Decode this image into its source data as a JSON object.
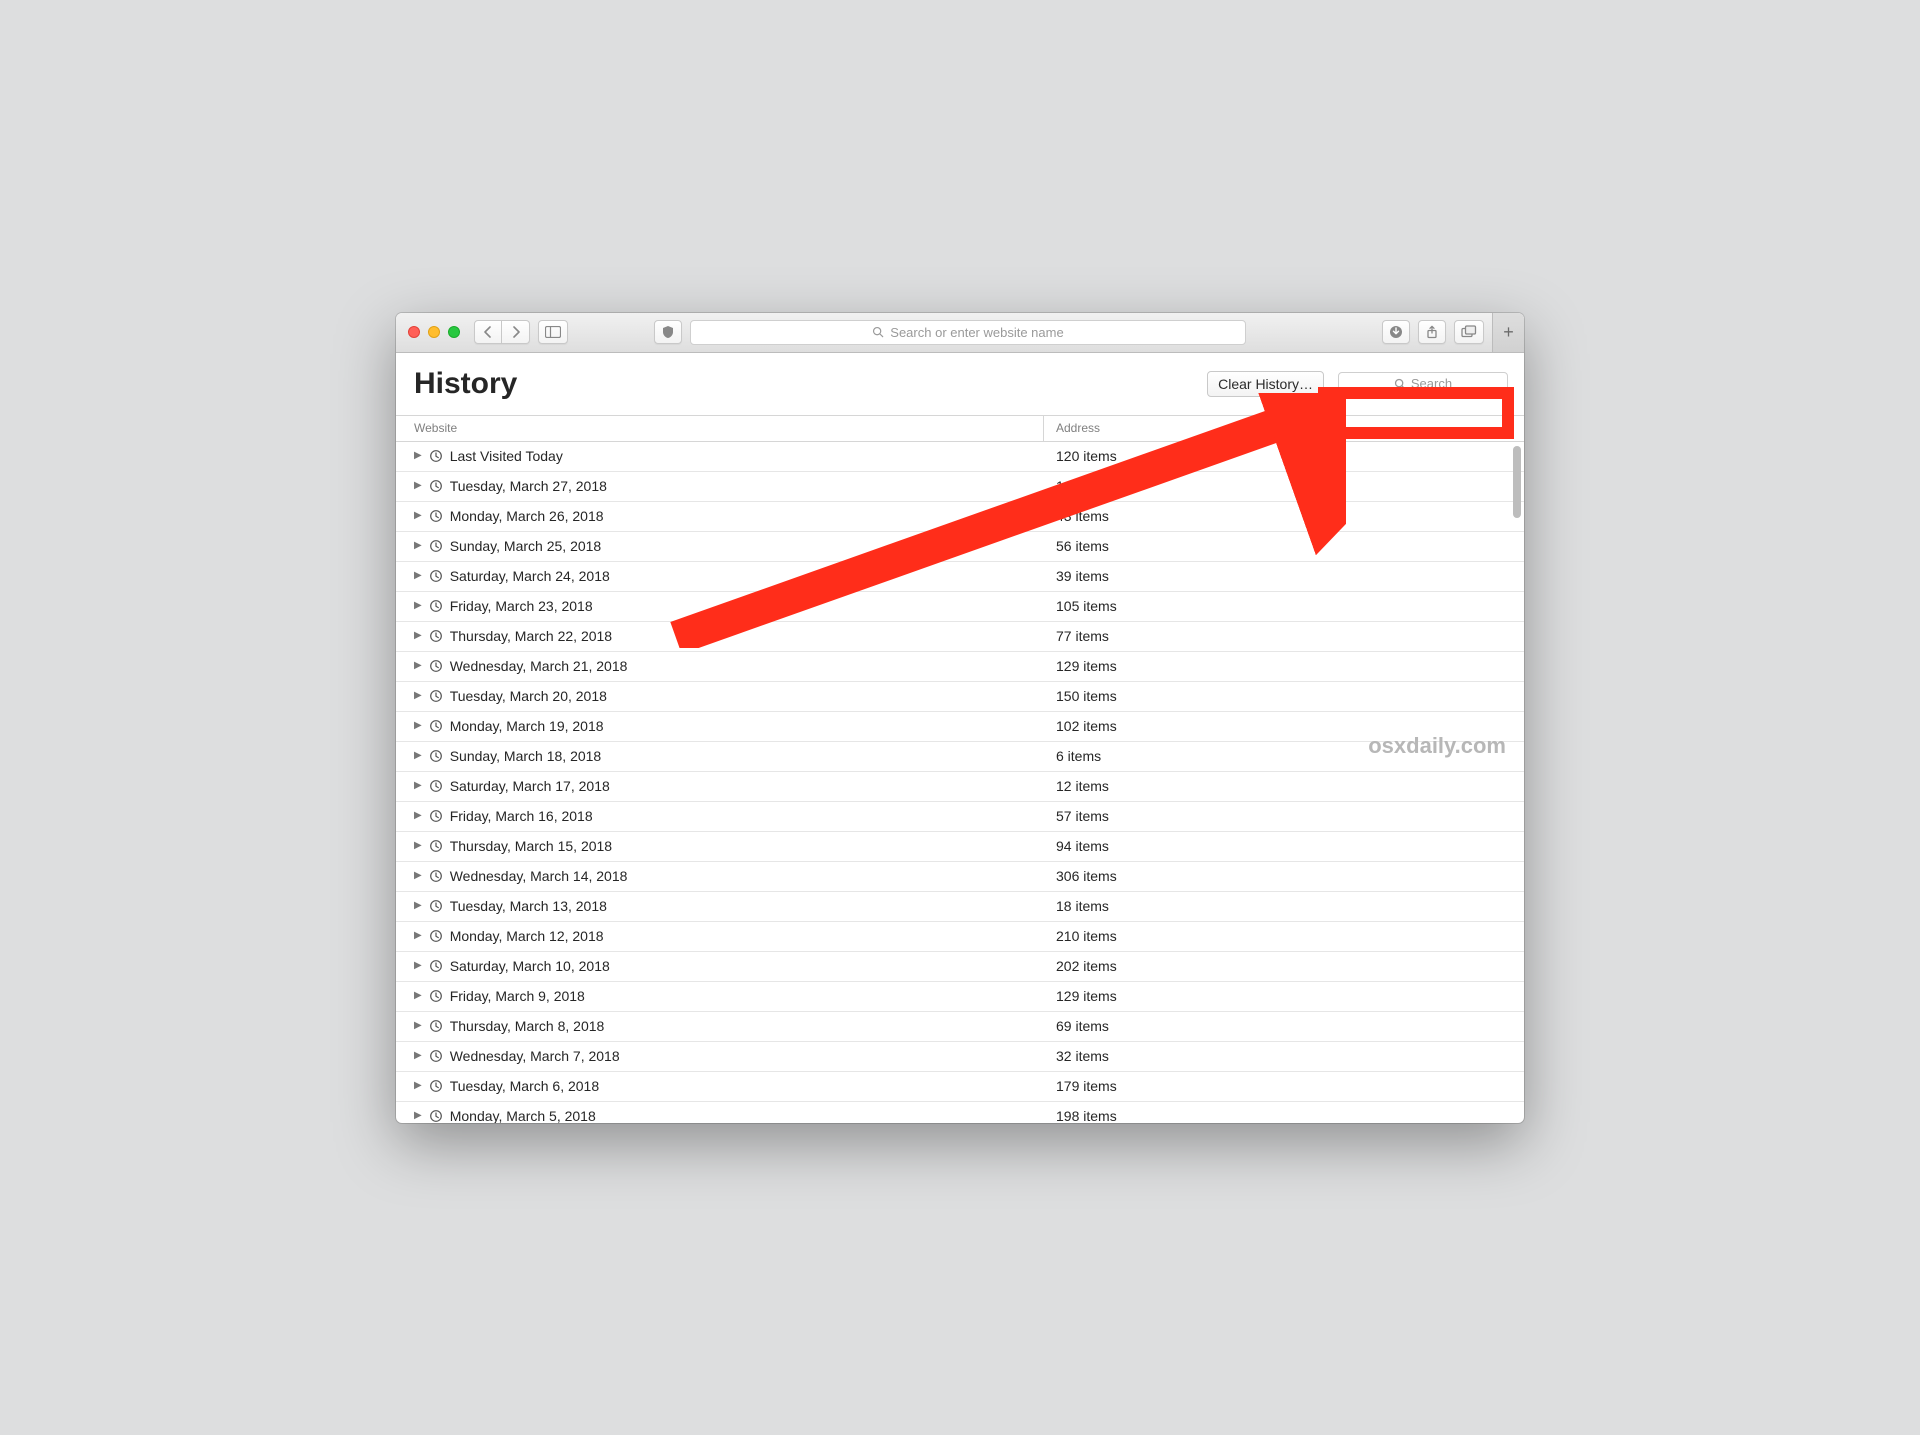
{
  "toolbar": {
    "address_placeholder": "Search or enter website name"
  },
  "history": {
    "title": "History",
    "clear_label": "Clear History…",
    "search_placeholder": "Search",
    "columns": {
      "website": "Website",
      "address": "Address"
    },
    "rows": [
      {
        "label": "Last Visited Today",
        "count": "120 items"
      },
      {
        "label": "Tuesday, March 27, 2018",
        "count": "196 items"
      },
      {
        "label": "Monday, March 26, 2018",
        "count": "43 items"
      },
      {
        "label": "Sunday, March 25, 2018",
        "count": "56 items"
      },
      {
        "label": "Saturday, March 24, 2018",
        "count": "39 items"
      },
      {
        "label": "Friday, March 23, 2018",
        "count": "105 items"
      },
      {
        "label": "Thursday, March 22, 2018",
        "count": "77 items"
      },
      {
        "label": "Wednesday, March 21, 2018",
        "count": "129 items"
      },
      {
        "label": "Tuesday, March 20, 2018",
        "count": "150 items"
      },
      {
        "label": "Monday, March 19, 2018",
        "count": "102 items"
      },
      {
        "label": "Sunday, March 18, 2018",
        "count": "6 items"
      },
      {
        "label": "Saturday, March 17, 2018",
        "count": "12 items"
      },
      {
        "label": "Friday, March 16, 2018",
        "count": "57 items"
      },
      {
        "label": "Thursday, March 15, 2018",
        "count": "94 items"
      },
      {
        "label": "Wednesday, March 14, 2018",
        "count": "306 items"
      },
      {
        "label": "Tuesday, March 13, 2018",
        "count": "18 items"
      },
      {
        "label": "Monday, March 12, 2018",
        "count": "210 items"
      },
      {
        "label": "Saturday, March 10, 2018",
        "count": "202 items"
      },
      {
        "label": "Friday, March 9, 2018",
        "count": "129 items"
      },
      {
        "label": "Thursday, March 8, 2018",
        "count": "69 items"
      },
      {
        "label": "Wednesday, March 7, 2018",
        "count": "32 items"
      },
      {
        "label": "Tuesday, March 6, 2018",
        "count": "179 items"
      },
      {
        "label": "Monday, March 5, 2018",
        "count": "198 items"
      }
    ]
  },
  "watermark": "osxdaily.com"
}
